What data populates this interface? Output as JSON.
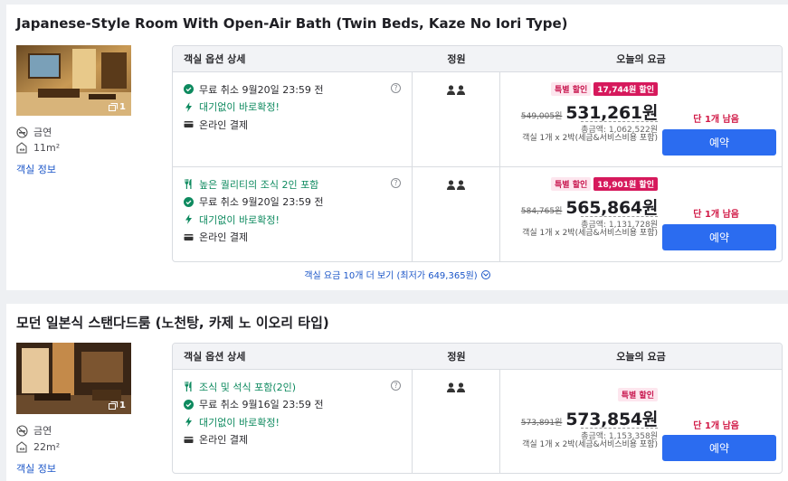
{
  "rooms": [
    {
      "title": "Japanese-Style Room With Open-Air Bath (Twin Beds, Kaze No Iori Type)",
      "photo_count": "1",
      "smoking": "금연",
      "size": "11m²",
      "info_link": "객실 정보",
      "table_headers": {
        "option": "객실 옵션 상세",
        "capacity": "정원",
        "price": "오늘의 요금"
      },
      "rates": [
        {
          "options": [
            {
              "icon": "check-circle-icon",
              "text": "무료 취소 9월20일 23:59 전"
            },
            {
              "icon": "lightning-icon",
              "text": "대기없이 바로확정!"
            },
            {
              "icon": "card-icon",
              "text": "온라인 결제"
            }
          ],
          "badge_sale": "특별 할인",
          "badge_amount": "17,744원 할인",
          "old_price": "549,005원",
          "new_price": "531,261원",
          "total": "총금액: 1,062,522원",
          "note": "객실 1개 x 2박(세금&서비스비용 포함)",
          "left": "단 1개 남음",
          "reserve": "예약"
        },
        {
          "options": [
            {
              "icon": "fork-knife-icon",
              "text": "높은 퀄리티의 조식 2인 포함"
            },
            {
              "icon": "check-circle-icon",
              "text": "무료 취소 9월20일 23:59 전"
            },
            {
              "icon": "lightning-icon",
              "text": "대기없이 바로확정!"
            },
            {
              "icon": "card-icon",
              "text": "온라인 결제"
            }
          ],
          "badge_sale": "특별 할인",
          "badge_amount": "18,901원 할인",
          "old_price": "584,765원",
          "new_price": "565,864원",
          "total": "총금액: 1,131,728원",
          "note": "객실 1개 x 2박(세금&서비스비용 포함)",
          "left": "단 1개 남음",
          "reserve": "예약"
        }
      ],
      "more_link": "객실 요금 10개 더 보기 (최저가 649,365원)"
    },
    {
      "title": "모던 일본식 스탠다드룸 (노천탕, 카제 노 이오리 타입)",
      "photo_count": "1",
      "smoking": "금연",
      "size": "22m²",
      "info_link": "객실 정보",
      "table_headers": {
        "option": "객실 옵션 상세",
        "capacity": "정원",
        "price": "오늘의 요금"
      },
      "rates": [
        {
          "options": [
            {
              "icon": "fork-knife-icon",
              "text": "조식 및 석식 포함(2인)"
            },
            {
              "icon": "check-circle-icon",
              "text": "무료 취소 9월16일 23:59 전"
            },
            {
              "icon": "lightning-icon",
              "text": "대기없이 바로확정!"
            },
            {
              "icon": "card-icon",
              "text": "온라인 결제"
            }
          ],
          "badge_sale": "특별 할인",
          "old_price": "573,891원",
          "new_price": "573,854원",
          "total": "총금액: 1,153,358원",
          "note": "객실 1개 x 2박(세금&서비스비용 포함)",
          "left": "단 1개 남음",
          "reserve": "예약"
        }
      ]
    }
  ],
  "colors": {
    "accent": "#2b6cf0",
    "sale": "#d6195c",
    "green": "#0e8a5f",
    "link": "#1a55c8"
  }
}
